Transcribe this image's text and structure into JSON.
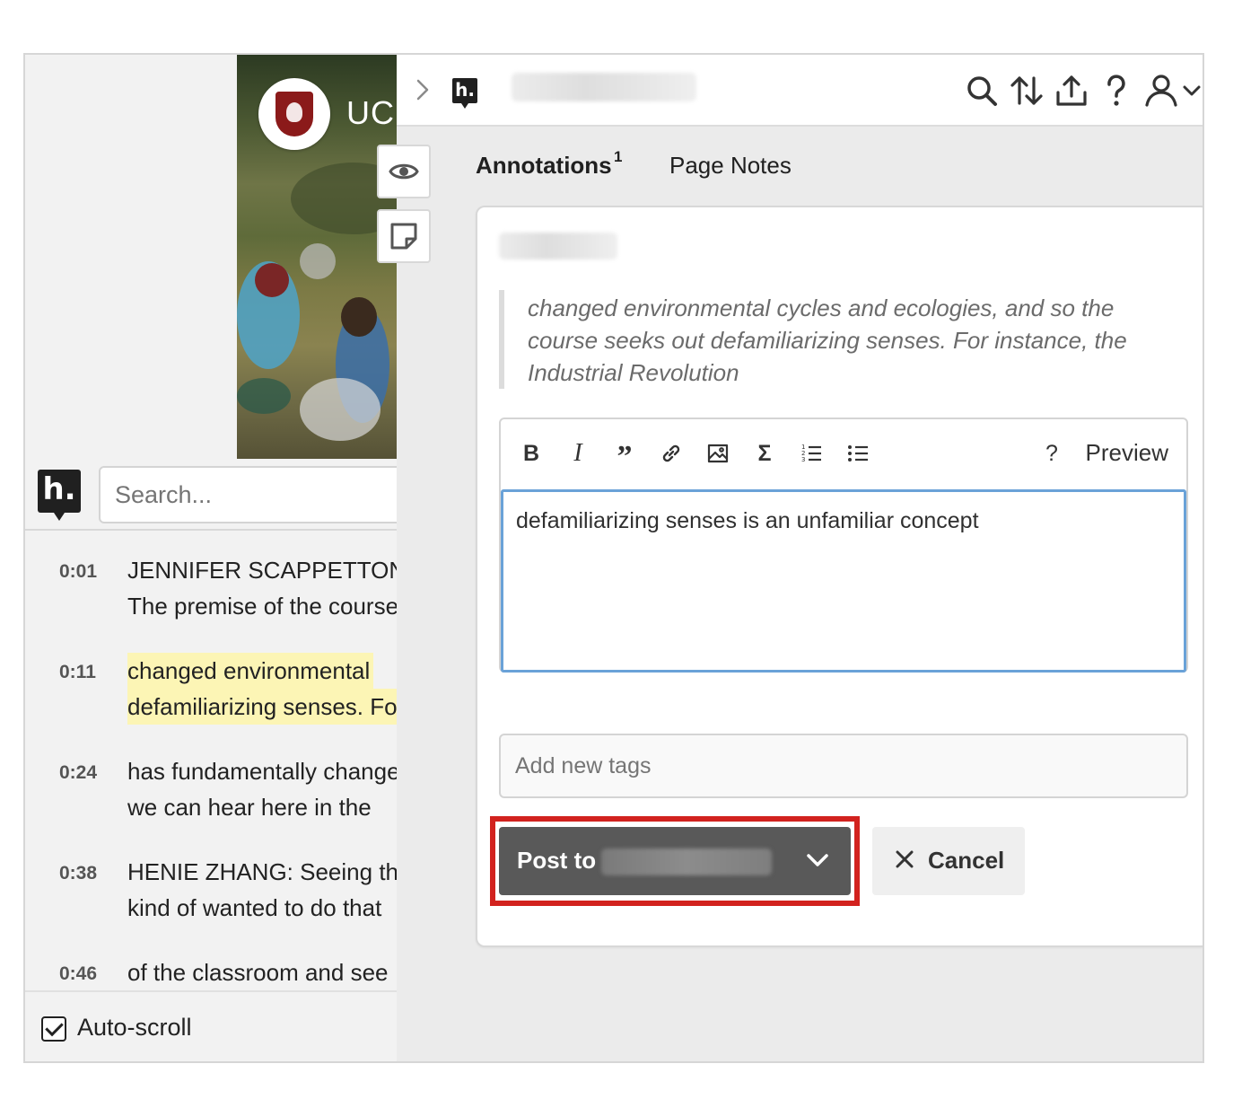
{
  "page": {
    "uc_overlay_text": "UC"
  },
  "search": {
    "placeholder": "Search...",
    "logo_text": "h."
  },
  "transcript": [
    {
      "time": "0:01",
      "lines": [
        "JENNIFER SCAPPETTONE:",
        "The premise of the course"
      ],
      "highlighted": false
    },
    {
      "time": "0:11",
      "lines": [
        "changed environmental",
        "defamiliarizing senses. For"
      ],
      "highlighted": true
    },
    {
      "time": "0:24",
      "lines": [
        "has fundamentally changed",
        "we can hear here in the"
      ],
      "highlighted": false
    },
    {
      "time": "0:38",
      "lines": [
        "HENIE ZHANG: Seeing the",
        "kind of wanted to do that"
      ],
      "highlighted": false
    },
    {
      "time": "0:46",
      "lines": [
        "of the classroom and see"
      ],
      "highlighted": false
    }
  ],
  "autoscroll": {
    "label": "Auto-scroll",
    "checked": true
  },
  "sidebar": {
    "collapse_glyph": "›",
    "logo_text": "h.",
    "toolbar_icons": [
      "search-icon",
      "sort-icon",
      "share-icon",
      "help-icon",
      "user-icon",
      "chevron-down-icon"
    ],
    "side_tools": [
      "eye-icon",
      "page-note-icon"
    ],
    "tabs": {
      "annotations_label": "Annotations",
      "annotations_count": "1",
      "page_notes_label": "Page Notes"
    },
    "card": {
      "quote": "changed environmental cycles and ecologies, and so the course seeks out defamiliarizing senses. For instance, the Industrial Revolution",
      "editor": {
        "toolbar": [
          "bold-icon",
          "italic-icon",
          "quote-icon",
          "link-icon",
          "image-icon",
          "math-icon",
          "numbered-list-icon",
          "bulleted-list-icon"
        ],
        "help_label": "?",
        "preview_label": "Preview",
        "text": "defamiliarizing senses is an unfamiliar concept"
      },
      "tags_placeholder": "Add new tags",
      "post_button_label": "Post to",
      "cancel_button_label": "Cancel"
    }
  },
  "colors": {
    "highlight": "#fcf5b5",
    "post_button": "#595959",
    "annotation_callout": "#d2221e",
    "editor_focus": "#6aa2d8"
  }
}
